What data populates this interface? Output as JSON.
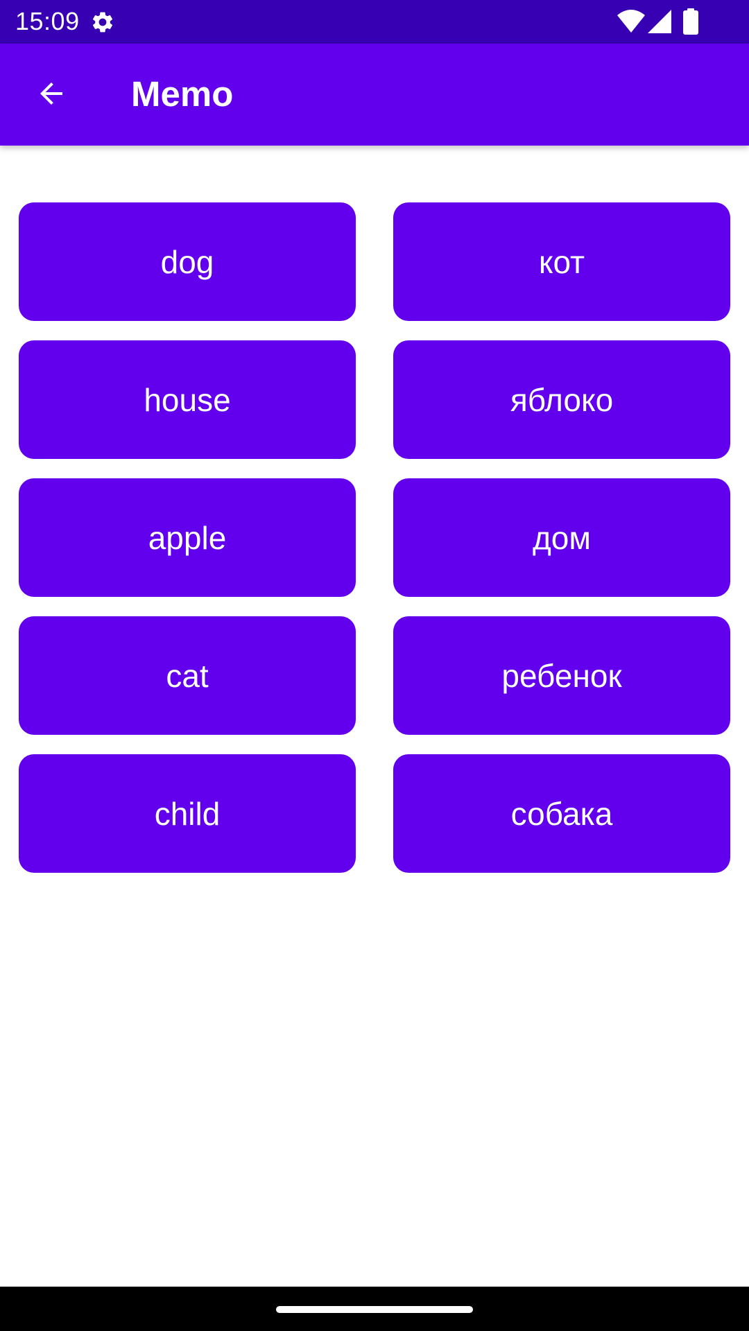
{
  "status_bar": {
    "time": "15:09",
    "icons": [
      "gear-icon",
      "wifi-icon",
      "signal-icon",
      "battery-icon"
    ]
  },
  "app_bar": {
    "title": "Memo",
    "back_icon": "arrow-back-icon"
  },
  "cards": {
    "left": [
      "dog",
      "house",
      "apple",
      "cat",
      "child"
    ],
    "right": [
      "кот",
      "яблоко",
      "дом",
      "ребенок",
      "собака"
    ]
  },
  "colors": {
    "status_bar": "#3700b3",
    "primary": "#6200ee",
    "card_text": "#ffffff",
    "background": "#ffffff"
  }
}
